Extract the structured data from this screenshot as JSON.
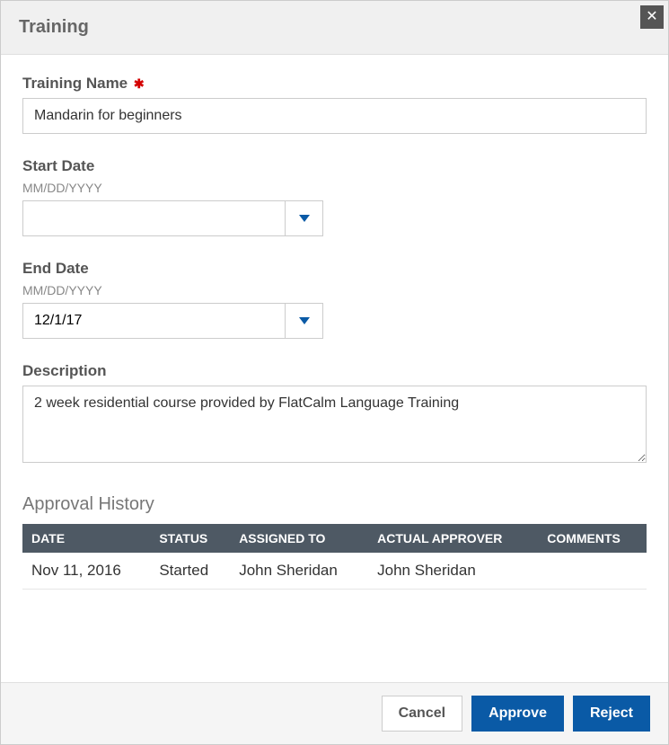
{
  "dialog": {
    "title": "Training"
  },
  "form": {
    "training_name": {
      "label": "Training Name",
      "value": "Mandarin for beginners"
    },
    "start_date": {
      "label": "Start Date",
      "hint": "MM/DD/YYYY",
      "value": ""
    },
    "end_date": {
      "label": "End Date",
      "hint": "MM/DD/YYYY",
      "value": "12/1/17"
    },
    "description": {
      "label": "Description",
      "value": "2 week residential course provided by FlatCalm Language Training"
    }
  },
  "approval": {
    "section_title": "Approval History",
    "headers": {
      "date": "DATE",
      "status": "STATUS",
      "assigned_to": "ASSIGNED TO",
      "actual_approver": "ACTUAL APPROVER",
      "comments": "COMMENTS"
    },
    "rows": [
      {
        "date": "Nov 11, 2016",
        "status": "Started",
        "assigned_to": "John Sheridan",
        "actual_approver": "John Sheridan",
        "comments": ""
      }
    ]
  },
  "footer": {
    "cancel": "Cancel",
    "approve": "Approve",
    "reject": "Reject"
  }
}
